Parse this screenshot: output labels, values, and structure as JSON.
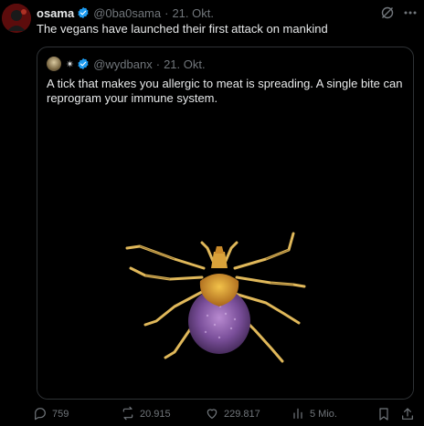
{
  "tweet": {
    "author_name": "osama",
    "handle": "@0ba0sama",
    "separator": "·",
    "date": "21. Okt.",
    "text": "The vegans have launched their first attack on mankind"
  },
  "quote": {
    "star": "✴",
    "handle": "@wydbanx",
    "separator": "·",
    "date": "21. Okt.",
    "text": "A tick that makes you allergic to meat is spreading. A single bite can reprogram your immune system."
  },
  "actions": {
    "replies": "759",
    "reposts": "20.915",
    "likes": "229.817",
    "views": "5 Mio."
  },
  "icons": {
    "verified": "verified-badge-icon",
    "grok": "grok-icon",
    "more": "more-options-icon",
    "reply": "reply-icon",
    "repost": "repost-icon",
    "like": "heart-icon",
    "views": "views-icon",
    "bookmark": "bookmark-icon",
    "share": "share-icon"
  },
  "colors": {
    "background": "#000000",
    "text": "#e7e9ea",
    "muted": "#71767b",
    "verified": "#1d9bf0",
    "border": "#2f3336"
  }
}
